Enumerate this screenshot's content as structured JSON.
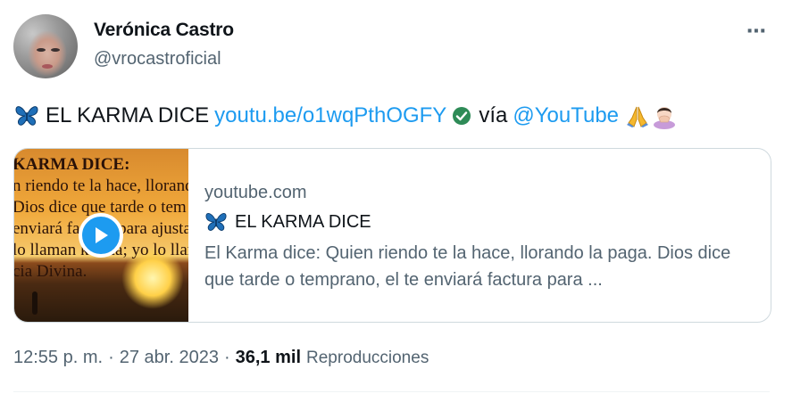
{
  "author": {
    "name": "Verónica Castro",
    "handle": "@vrocastroficial"
  },
  "more_icon": "⋯",
  "tweet": {
    "text_before": "EL KARMA DICE",
    "link": "youtu.be/o1wqPthOGFY",
    "via": "vía",
    "mention": "@YouTube",
    "emojis": [
      "butterfly-emoji",
      "verified-check-icon",
      "folded-hands-emoji",
      "facepalm-emoji"
    ]
  },
  "card": {
    "domain": "youtube.com",
    "title": "EL KARMA DICE",
    "description": "El Karma dice: Quien riendo te la hace, llorando la paga. Dios dice que tarde o temprano, el te enviará factura para ...",
    "thumbnail_text": [
      "KARMA DICE:",
      "n riendo te la hace, llorando",
      "Dios dice que tarde o tem",
      "enviará factura para ajustar",
      "lo llaman karma; yo lo llam",
      "cia Divina."
    ]
  },
  "meta": {
    "time": "12:55 p. m.",
    "date": "27 abr. 2023",
    "views": "36,1 mil",
    "views_label": "Reproducciones"
  },
  "colors": {
    "link": "#1d9bf0",
    "secondary": "#536471",
    "verified": "#2e8b57"
  }
}
